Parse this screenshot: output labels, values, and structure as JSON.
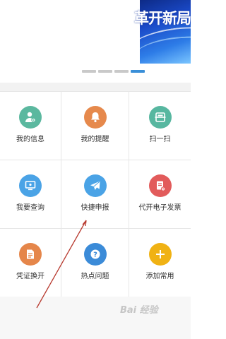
{
  "banner": {
    "text": "革开新局"
  },
  "pager": {
    "active_index": 3,
    "total": 4
  },
  "grid": [
    {
      "label": "我的信息",
      "icon": "person-gear-icon",
      "color": "#5bb89f"
    },
    {
      "label": "我的提醒",
      "icon": "bell-icon",
      "color": "#e6894c"
    },
    {
      "label": "扫一扫",
      "icon": "scan-icon",
      "color": "#57b7a0"
    },
    {
      "label": "我要查询",
      "icon": "monitor-icon",
      "color": "#4aa3e6"
    },
    {
      "label": "快捷申报",
      "icon": "paper-plane-icon",
      "color": "#4aa3e6"
    },
    {
      "label": "代开电子发票",
      "icon": "invoice-icon",
      "color": "#e25b5b"
    },
    {
      "label": "凭证换开",
      "icon": "document-icon",
      "color": "#e5864a"
    },
    {
      "label": "热点问题",
      "icon": "question-icon",
      "color": "#3b8bd8"
    },
    {
      "label": "添加常用",
      "icon": "plus-icon",
      "color": "#f0b214"
    }
  ],
  "watermark": "Bai 经验"
}
